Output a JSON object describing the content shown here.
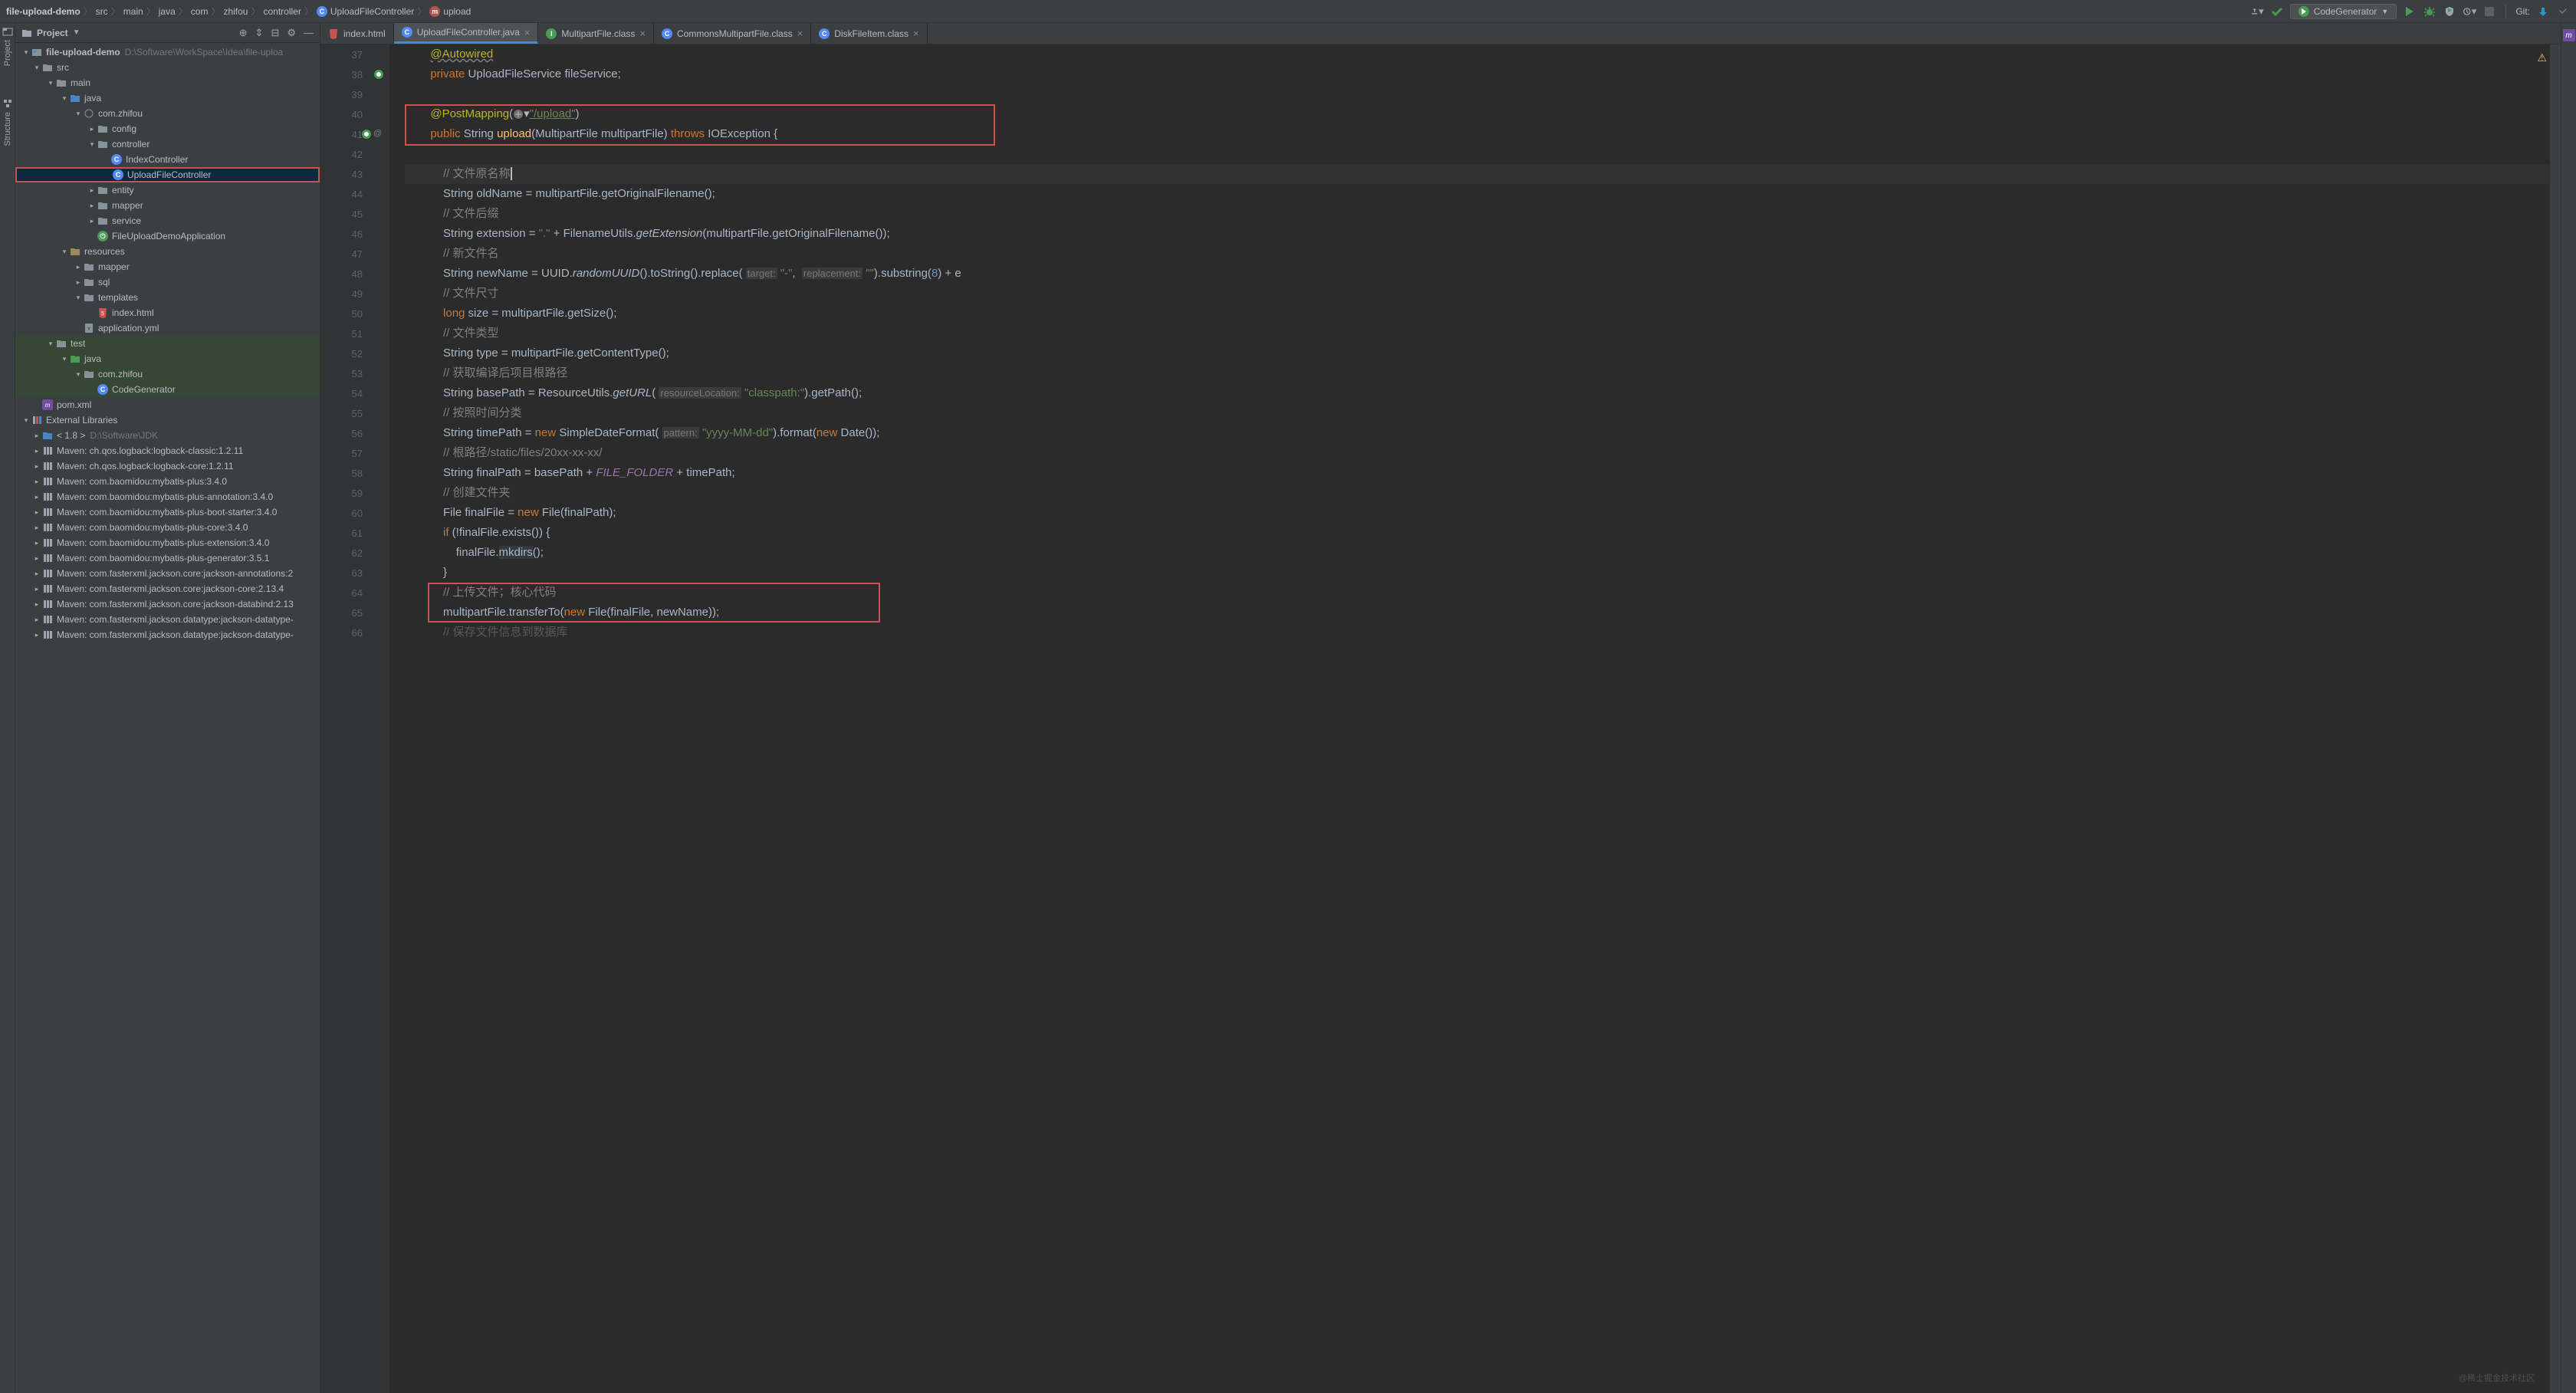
{
  "breadcrumb": [
    "file-upload-demo",
    "src",
    "main",
    "java",
    "com",
    "zhifou",
    "controller",
    "UploadFileController",
    "upload"
  ],
  "run_config": "CodeGenerator",
  "git_label": "Git:",
  "left_tabs": [
    "Project",
    "Structure"
  ],
  "project_header": "Project",
  "tree": {
    "root": {
      "label": "file-upload-demo",
      "path": "D:\\Software\\WorkSpace\\Idea\\file-uploa"
    },
    "src": "src",
    "main": "main",
    "java": "java",
    "pkg": "com.zhifou",
    "config": "config",
    "controller": "controller",
    "IndexController": "IndexController",
    "UploadFileController": "UploadFileController",
    "entity": "entity",
    "mapper": "mapper",
    "service": "service",
    "app": "FileUploadDemoApplication",
    "resources": "resources",
    "resmapper": "mapper",
    "sql": "sql",
    "templates": "templates",
    "indexhtml": "index.html",
    "appyml": "application.yml",
    "test": "test",
    "testjava": "java",
    "testpkg": "com.zhifou",
    "codegen": "CodeGenerator",
    "pom": "pom.xml",
    "extlib": "External Libraries",
    "jdk": "< 1.8 >",
    "jdkpath": "D:\\Software\\JDK",
    "libs": [
      "Maven: ch.qos.logback:logback-classic:1.2.11",
      "Maven: ch.qos.logback:logback-core:1.2.11",
      "Maven: com.baomidou:mybatis-plus:3.4.0",
      "Maven: com.baomidou:mybatis-plus-annotation:3.4.0",
      "Maven: com.baomidou:mybatis-plus-boot-starter:3.4.0",
      "Maven: com.baomidou:mybatis-plus-core:3.4.0",
      "Maven: com.baomidou:mybatis-plus-extension:3.4.0",
      "Maven: com.baomidou:mybatis-plus-generator:3.5.1",
      "Maven: com.fasterxml.jackson.core:jackson-annotations:2",
      "Maven: com.fasterxml.jackson.core:jackson-core:2.13.4",
      "Maven: com.fasterxml.jackson.core:jackson-databind:2.13",
      "Maven: com.fasterxml.jackson.datatype:jackson-datatype-",
      "Maven: com.fasterxml.jackson.datatype:jackson-datatype-"
    ]
  },
  "tabs": [
    {
      "label": "index.html",
      "type": "html"
    },
    {
      "label": "UploadFileController.java",
      "type": "class",
      "active": true
    },
    {
      "label": "MultipartFile.class",
      "type": "iface"
    },
    {
      "label": "CommonsMultipartFile.class",
      "type": "class"
    },
    {
      "label": "DiskFileItem.class",
      "type": "class"
    }
  ],
  "line_start": 37,
  "line_end": 66,
  "code": {
    "l37": {
      "anno": "@Autowired"
    },
    "l38": {
      "kw1": "private",
      "type": "UploadFileService",
      "field": "fileService",
      "semi": ";"
    },
    "l40": {
      "anno": "@PostMapping",
      "open": "(",
      "str": "\"/upload\"",
      "close": ")"
    },
    "l41": {
      "kw1": "public",
      "type": "String",
      "method": "upload",
      "params": "(MultipartFile multipartFile)",
      "kw2": "throws",
      "exc": "IOException {"
    },
    "l43": {
      "comment": "// 文件原名称"
    },
    "l44": {
      "type": "String",
      "var": "oldName = multipartFile.getOriginalFilename();"
    },
    "l45": {
      "comment": "// 文件后缀"
    },
    "l46_a": "String extension = ",
    "l46_b": "\".\"",
    "l46_c": " + FilenameUtils.",
    "l46_d": "getExtension",
    "l46_e": "(multipartFile.getOriginalFilename());",
    "l47": {
      "comment": "// 新文件名"
    },
    "l48_a": "String newName = UUID.",
    "l48_b": "randomUUID",
    "l48_c": "().toString().replace( ",
    "l48_h1": "target:",
    "l48_d": " \"-\"",
    "l48_e": ",  ",
    "l48_h2": "replacement:",
    "l48_f": " \"\"",
    "l48_g": ").substring(",
    "l48_n": "8",
    "l48_h": ") + e",
    "l49": {
      "comment": "// 文件尺寸"
    },
    "l50_a": "long",
    "l50_b": " size = multipartFile.getSize();",
    "l51": {
      "comment": "// 文件类型"
    },
    "l52": "String type = multipartFile.getContentType();",
    "l53": {
      "comment": "// 获取编译后项目根路径"
    },
    "l54_a": "String basePath = ResourceUtils.",
    "l54_b": "getURL",
    "l54_c": "( ",
    "l54_h": "resourceLocation:",
    "l54_d": " \"classpath:\"",
    "l54_e": ").getPath();",
    "l55": {
      "comment": "// 按照时间分类"
    },
    "l56_a": "String timePath = ",
    "l56_kw": "new",
    "l56_b": " SimpleDateFormat( ",
    "l56_h": "pattern:",
    "l56_c": " \"yyyy-MM-dd\"",
    "l56_d": ").format(",
    "l56_kw2": "new",
    "l56_e": " Date());",
    "l57": {
      "comment": "// 根路径/static/files/20xx-xx-xx/"
    },
    "l58_a": "String finalPath = basePath + ",
    "l58_b": "FILE_FOLDER",
    "l58_c": " + timePath;",
    "l59": {
      "comment": "// 创建文件夹"
    },
    "l60_a": "File finalFile = ",
    "l60_kw": "new",
    "l60_b": " File(finalPath);",
    "l61_a": "if",
    "l61_b": " (!finalFile.exists()) {",
    "l62_a": "finalFile.",
    "l62_b": "mkdirs",
    "l62_c": "();",
    "l63": "}",
    "l64": {
      "comment": "// 上传文件；核心代码"
    },
    "l65_a": "multipartFile.transferTo(",
    "l65_kw": "new",
    "l65_b": " File(finalFile, newName));",
    "l66": {
      "comment": "// 保存文件信息到数据库"
    }
  },
  "watermark": "@稀土掘金技术社区"
}
